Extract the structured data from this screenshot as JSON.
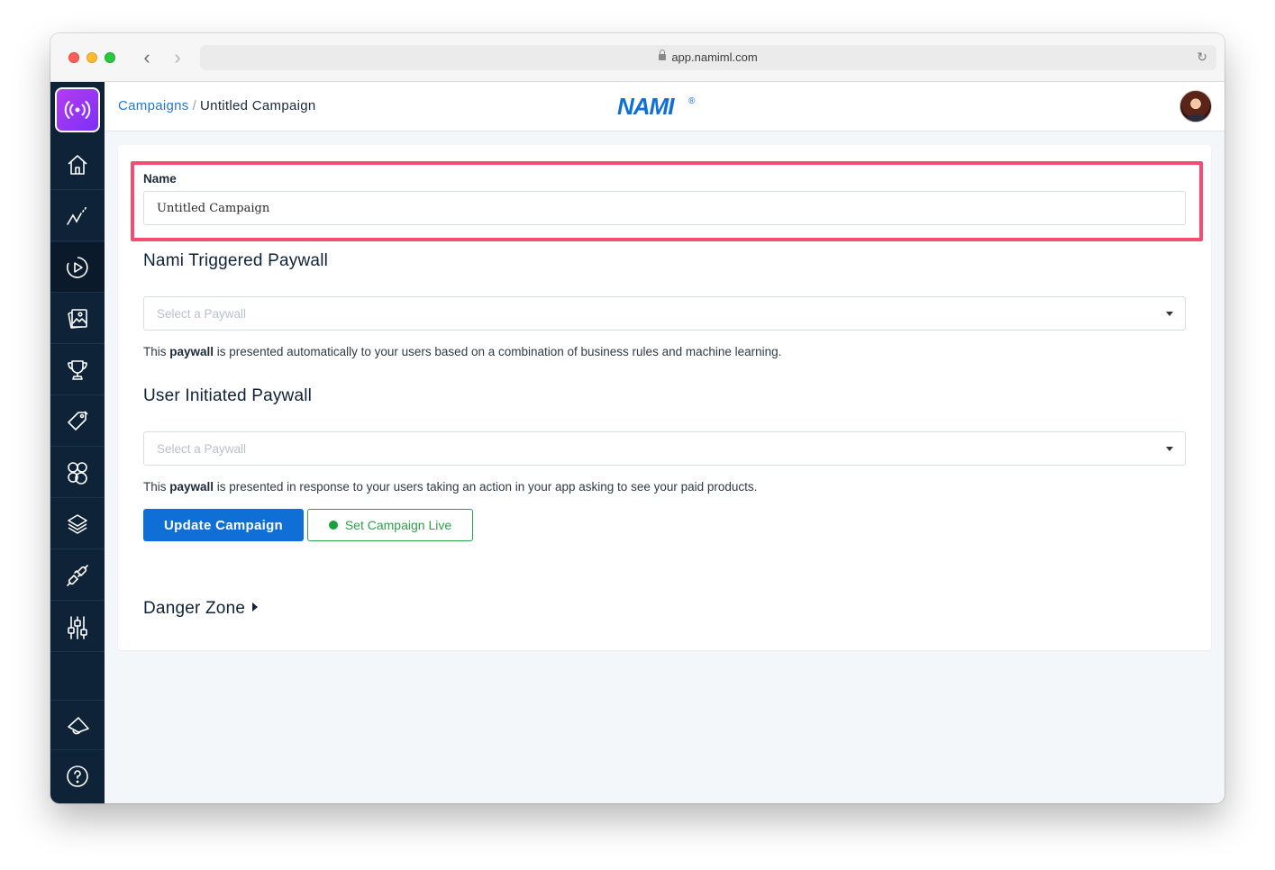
{
  "browser": {
    "url": "app.namiml.com"
  },
  "sidebar": {
    "items": [
      {
        "name": "home-icon"
      },
      {
        "name": "analytics-icon"
      },
      {
        "name": "campaigns-icon"
      },
      {
        "name": "paywalls-icon"
      },
      {
        "name": "trophy-icon"
      },
      {
        "name": "tag-icon"
      },
      {
        "name": "audiences-icon"
      },
      {
        "name": "layers-icon"
      },
      {
        "name": "integrations-icon"
      },
      {
        "name": "settings-sliders-icon"
      },
      {
        "name": "announcement-icon"
      },
      {
        "name": "help-icon"
      }
    ],
    "active": "campaigns-icon"
  },
  "header": {
    "breadcrumb_parent": "Campaigns",
    "breadcrumb_separator": "/",
    "breadcrumb_current": "Untitled Campaign",
    "brand": "NAMI",
    "brand_mark": "®"
  },
  "form": {
    "name_label": "Name",
    "name_value": "Untitled Campaign",
    "triggered_title": "Nami Triggered Paywall",
    "triggered_placeholder": "Select a Paywall",
    "triggered_help_prefix": "This ",
    "triggered_help_bold": "paywall",
    "triggered_help_suffix": " is presented automatically to your users based on a combination of business rules and machine learning.",
    "user_title": "User Initiated Paywall",
    "user_placeholder": "Select a Paywall",
    "user_help_prefix": "This ",
    "user_help_bold": "paywall",
    "user_help_suffix": " is presented in response to your users taking an action in your app asking to see your paid products.",
    "update_button": "Update Campaign",
    "live_button": "Set Campaign Live",
    "danger_zone": "Danger Zone"
  },
  "colors": {
    "accent": "#0f6fd6",
    "highlight": "#f44d71",
    "live": "#2aa14b",
    "sidebar": "#0f2338"
  }
}
